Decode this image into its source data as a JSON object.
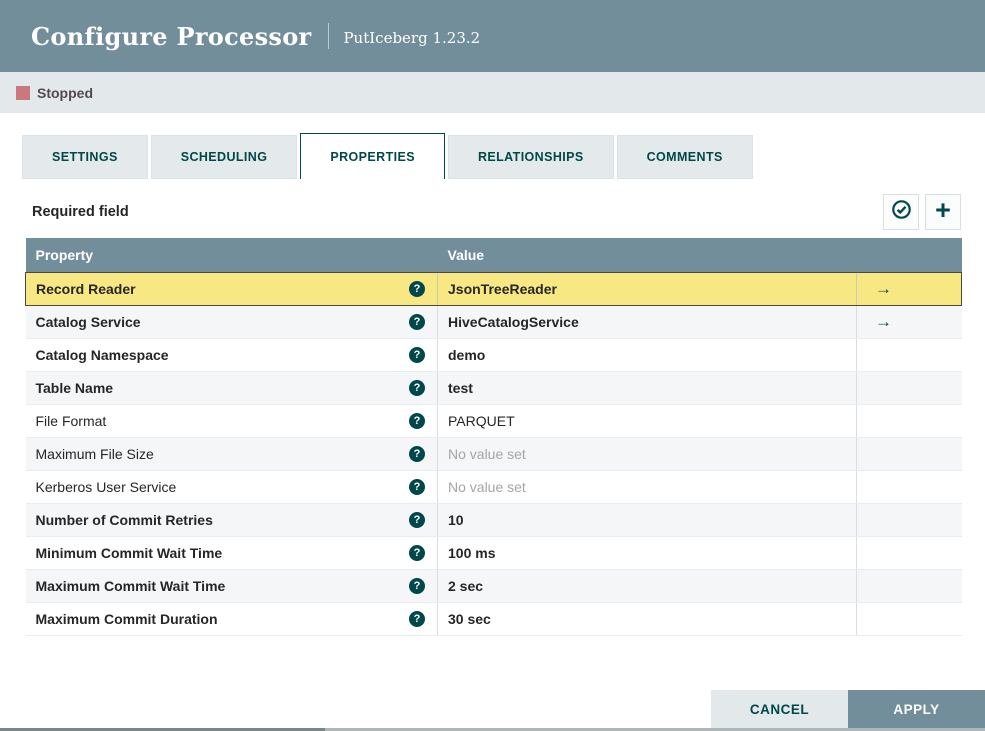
{
  "dialog": {
    "title": "Configure Processor",
    "subtitle": "PutIceberg 1.23.2",
    "status": {
      "label": "Stopped",
      "color": "#C9787E"
    },
    "tabs": [
      {
        "label": "SETTINGS",
        "active": false
      },
      {
        "label": "SCHEDULING",
        "active": false
      },
      {
        "label": "PROPERTIES",
        "active": true
      },
      {
        "label": "RELATIONSHIPS",
        "active": false
      },
      {
        "label": "COMMENTS",
        "active": false
      }
    ],
    "properties_tab": {
      "required_field_label": "Required field",
      "verify_button_icon": "check-circle-icon",
      "add_button_icon": "plus-icon",
      "plus_glyph": "+",
      "help_glyph": "?",
      "goto_glyph": "→",
      "table": {
        "columns": {
          "property": "Property",
          "value": "Value"
        },
        "rows": [
          {
            "property": "Record Reader",
            "value": "JsonTreeReader",
            "required": true,
            "selected": true,
            "unset": false,
            "has_goto": true
          },
          {
            "property": "Catalog Service",
            "value": "HiveCatalogService",
            "required": true,
            "selected": false,
            "unset": false,
            "has_goto": true
          },
          {
            "property": "Catalog Namespace",
            "value": "demo",
            "required": true,
            "selected": false,
            "unset": false,
            "has_goto": false
          },
          {
            "property": "Table Name",
            "value": "test",
            "required": true,
            "selected": false,
            "unset": false,
            "has_goto": false
          },
          {
            "property": "File Format",
            "value": "PARQUET",
            "required": false,
            "selected": false,
            "unset": false,
            "has_goto": false
          },
          {
            "property": "Maximum File Size",
            "value": "No value set",
            "required": false,
            "selected": false,
            "unset": true,
            "has_goto": false
          },
          {
            "property": "Kerberos User Service",
            "value": "No value set",
            "required": false,
            "selected": false,
            "unset": true,
            "has_goto": false
          },
          {
            "property": "Number of Commit Retries",
            "value": "10",
            "required": true,
            "selected": false,
            "unset": false,
            "has_goto": false
          },
          {
            "property": "Minimum Commit Wait Time",
            "value": "100 ms",
            "required": true,
            "selected": false,
            "unset": false,
            "has_goto": false
          },
          {
            "property": "Maximum Commit Wait Time",
            "value": "2 sec",
            "required": true,
            "selected": false,
            "unset": false,
            "has_goto": false
          },
          {
            "property": "Maximum Commit Duration",
            "value": "30 sec",
            "required": true,
            "selected": false,
            "unset": false,
            "has_goto": false
          }
        ]
      }
    },
    "footer": {
      "cancel_label": "CANCEL",
      "apply_label": "APPLY"
    },
    "colors": {
      "header_bg": "#728E9B",
      "status_bar_bg": "#E3E8EB",
      "accent_teal": "#004849",
      "selected_row_bg": "#F7E883",
      "alt_row_bg": "#F4F6F7",
      "unset_text": "#A5A5A5"
    }
  }
}
